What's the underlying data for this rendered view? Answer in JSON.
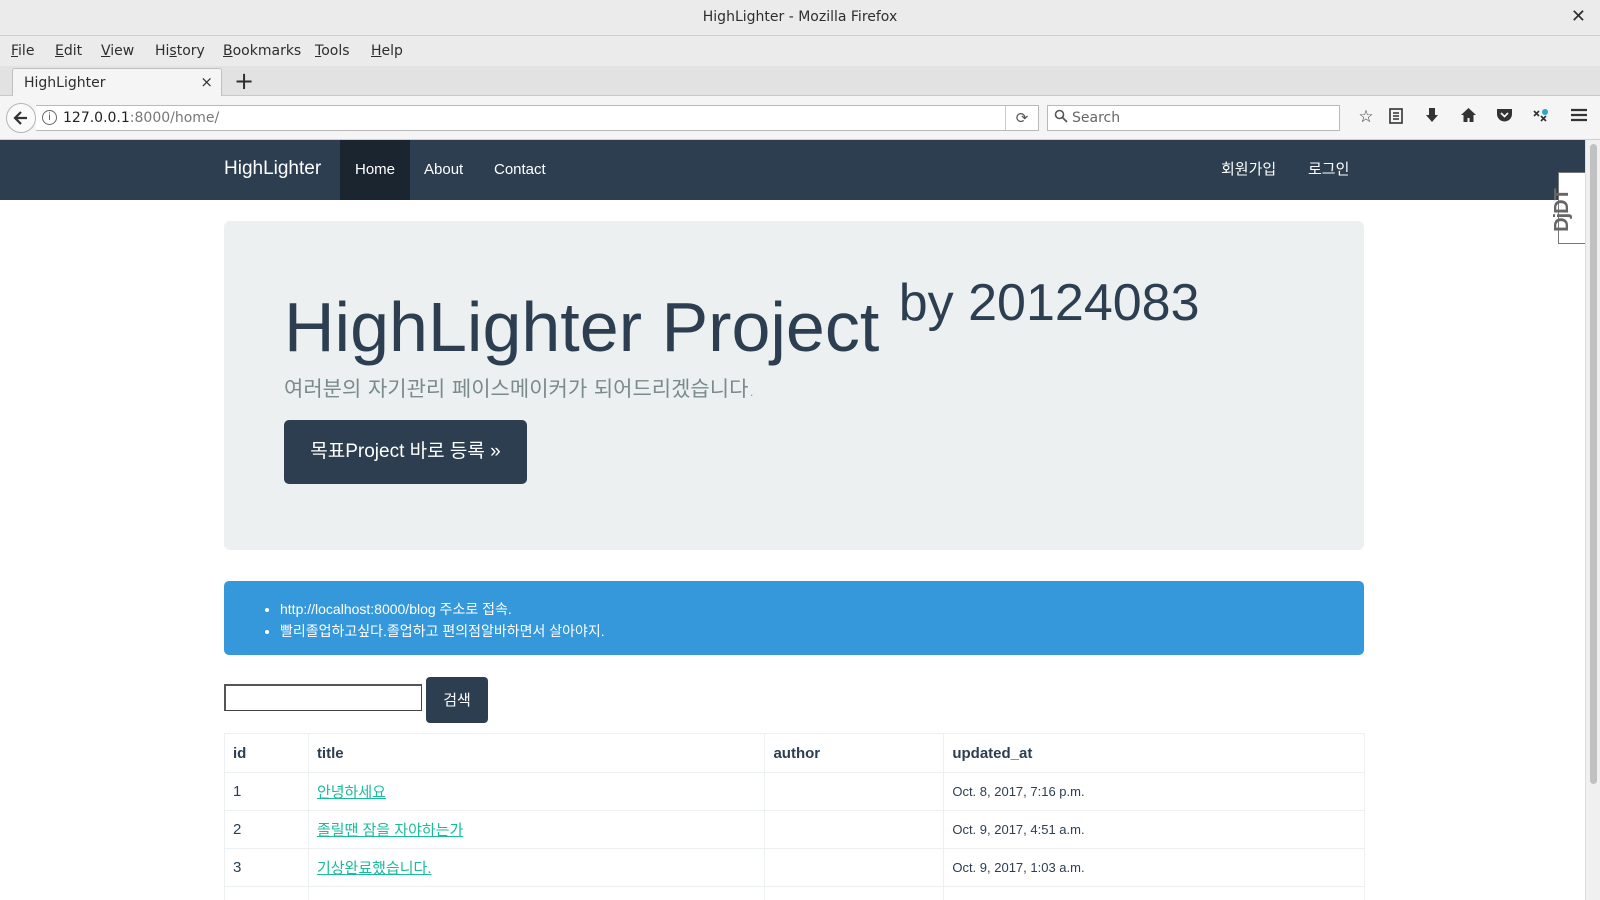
{
  "window": {
    "title": "HighLighter - Mozilla Firefox",
    "close_glyph": "✕"
  },
  "menu": [
    {
      "label": "File",
      "accel": "F",
      "rest": "ile"
    },
    {
      "label": "Edit",
      "accel": "E",
      "rest": "dit"
    },
    {
      "label": "View",
      "accel": "V",
      "rest": "iew"
    },
    {
      "label": "History",
      "accel": "s",
      "pre": "Hi",
      "rest": "tory"
    },
    {
      "label": "Bookmarks",
      "accel": "B",
      "rest": "ookmarks"
    },
    {
      "label": "Tools",
      "accel": "T",
      "rest": "ools"
    },
    {
      "label": "Help",
      "accel": "H",
      "rest": "elp"
    }
  ],
  "tab": {
    "label": "HighLighter",
    "close_glyph": "×",
    "new_tab_glyph": "+"
  },
  "address": {
    "host": "127.0.0.1",
    "rest": ":8000/home/"
  },
  "search": {
    "placeholder": "Search"
  },
  "icons": {
    "back": "back-arrow-icon",
    "info": "info-icon",
    "reload": "reload-icon",
    "search": "search-icon",
    "bookmark": "star-icon",
    "reader": "clipboard-icon",
    "download": "download-icon",
    "home": "home-icon",
    "pocket": "pocket-icon",
    "extension": "extension-icon",
    "menu": "hamburger-menu-icon"
  },
  "site": {
    "brand": "HighLighter",
    "nav": [
      {
        "label": "Home",
        "active": true
      },
      {
        "label": "About",
        "active": false
      },
      {
        "label": "Contact",
        "active": false
      }
    ],
    "nav_right": [
      {
        "label": "회원가입"
      },
      {
        "label": "로그인"
      }
    ],
    "djdt": "DjDT"
  },
  "jumbotron": {
    "title": "HighLighter Project",
    "title_sup": "by 20124083",
    "lead": "여러분의 자기관리 페이스메이커가 되어드리겠습니다.",
    "cta": "목표Project 바로 등록 »"
  },
  "notice": {
    "items": [
      "http://localhost:8000/blog 주소로 접속.",
      "빨리졸업하고싶다.졸업하고 편의점알바하면서 살아야지."
    ]
  },
  "search_form": {
    "value": "",
    "button": "검색"
  },
  "table": {
    "headers": [
      "id",
      "title",
      "author",
      "updated_at"
    ],
    "rows": [
      {
        "id": "1",
        "title": "안녕하세요",
        "author": "",
        "updated_at": "Oct. 8, 2017, 7:16 p.m."
      },
      {
        "id": "2",
        "title": "졸릴땐 잠을 자야하는가",
        "author": "",
        "updated_at": "Oct. 9, 2017, 4:51 a.m."
      },
      {
        "id": "3",
        "title": "기상완료했습니다.",
        "author": "",
        "updated_at": "Oct. 9, 2017, 1:03 a.m."
      }
    ]
  },
  "colors": {
    "primary": "#2c3e50",
    "info": "#3498db",
    "link": "#18bc9c",
    "jumbotron_bg": "#ecf0f1"
  }
}
